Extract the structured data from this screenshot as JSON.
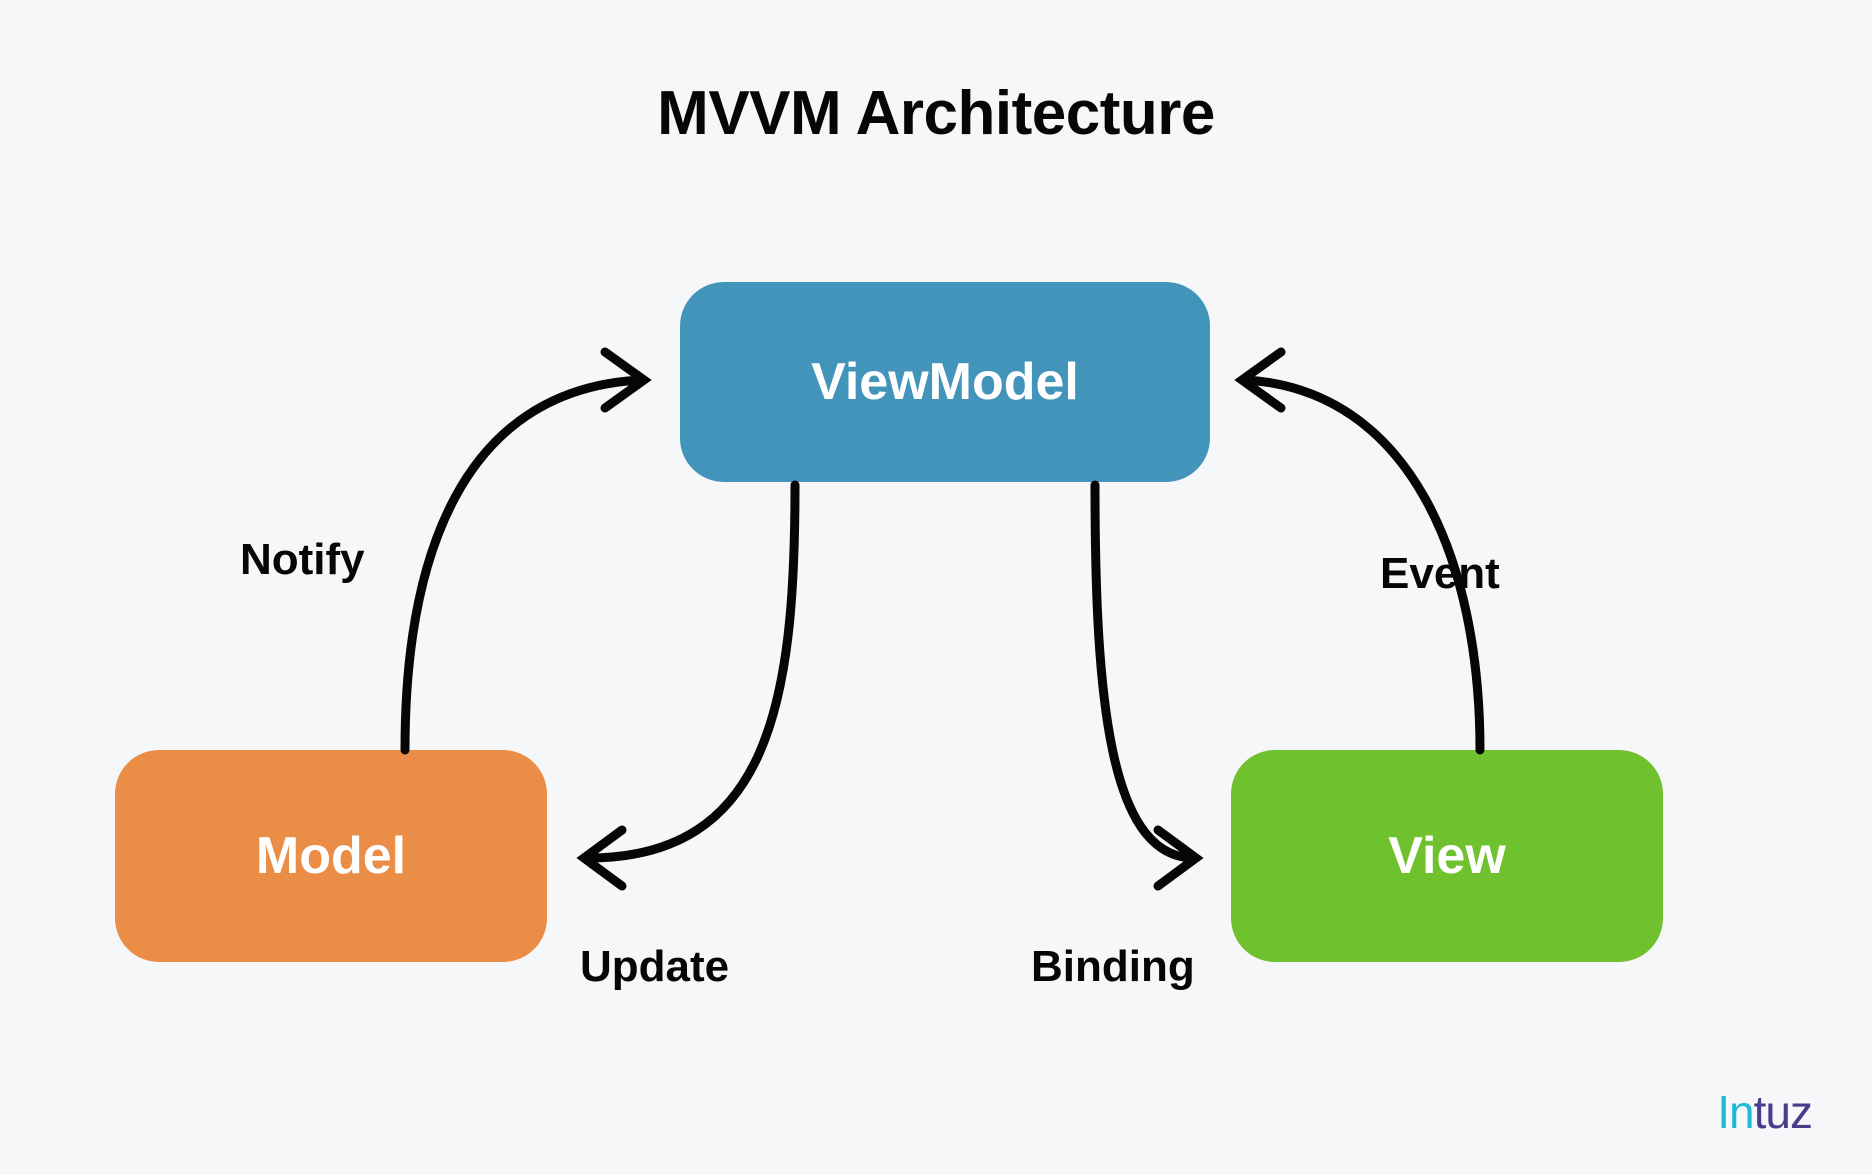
{
  "title": "MVVM Architecture",
  "nodes": {
    "viewmodel": {
      "label": "ViewModel",
      "color": "#4294bb"
    },
    "model": {
      "label": "Model",
      "color": "#e98d47"
    },
    "view": {
      "label": "View",
      "color": "#6fc22e"
    }
  },
  "edges": {
    "notify": {
      "label": "Notify",
      "from": "model",
      "to": "viewmodel"
    },
    "update": {
      "label": "Update",
      "from": "viewmodel",
      "to": "model"
    },
    "binding": {
      "label": "Binding",
      "from": "viewmodel",
      "to": "view"
    },
    "event": {
      "label": "Event",
      "from": "view",
      "to": "viewmodel"
    }
  },
  "brand": {
    "part1": "In",
    "part2": "tuz"
  },
  "colors": {
    "background": "#f6f7f8",
    "text": "#060606",
    "arrow": "#060606",
    "brand_cyan": "#1fbad6",
    "brand_indigo": "#4a3c8c"
  }
}
